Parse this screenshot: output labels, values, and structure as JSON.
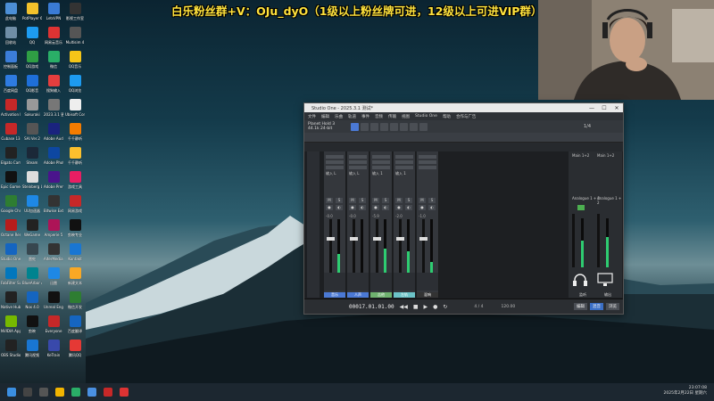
{
  "banner": {
    "text": "白乐粉丝群+V：OJu_dyO（1级以上粉丝牌可进，12级以上可进VIP群）"
  },
  "desktop": {
    "icons": [
      {
        "label": "此电脑",
        "color": "#4c8fd6"
      },
      {
        "label": "PotPlayer 64 bit",
        "color": "#f3c22b"
      },
      {
        "label": "LetsVPN",
        "color": "#3a7bd5"
      },
      {
        "label": "影视工作室",
        "color": "#333"
      },
      {
        "label": "回收站",
        "color": "#6f8ea6"
      },
      {
        "label": "QQ",
        "color": "#1d9bf0"
      },
      {
        "label": "网易云音乐",
        "color": "#d33"
      },
      {
        "label": "Multisim 4",
        "color": "#555"
      },
      {
        "label": "控制面板",
        "color": "#3b7dd8"
      },
      {
        "label": "QQ游戏",
        "color": "#2f9e44"
      },
      {
        "label": "微信",
        "color": "#2aae67"
      },
      {
        "label": "QQ音乐",
        "color": "#f5c518"
      },
      {
        "label": "百度网盘",
        "color": "#2e7be0"
      },
      {
        "label": "QQ影音",
        "color": "#1e6fd9"
      },
      {
        "label": "搜狗输入",
        "color": "#e53e3e"
      },
      {
        "label": "QQ浏览",
        "color": "#1d9bf0"
      },
      {
        "label": "Activation Manager",
        "color": "#c62828"
      },
      {
        "label": "Sakuraki",
        "color": "#999"
      },
      {
        "label": "2023.3.1 更新",
        "color": "#777"
      },
      {
        "label": "Ubisoft Connect",
        "color": "#eee"
      },
      {
        "label": "Cubase 13",
        "color": "#c62828"
      },
      {
        "label": "SAI Ver.2",
        "color": "#555"
      },
      {
        "label": "Adobe Audit",
        "color": "#1a237e"
      },
      {
        "label": "千千静听",
        "color": "#f57c00"
      },
      {
        "label": "Elgato Camera",
        "color": "#222"
      },
      {
        "label": "Steam",
        "color": "#1b2838"
      },
      {
        "label": "Adobe Photosh",
        "color": "#0d47a1"
      },
      {
        "label": "千千静听",
        "color": "#fbc02d"
      },
      {
        "label": "Epic Games Launcher",
        "color": "#111"
      },
      {
        "label": "Steinberg Library",
        "color": "#ddd"
      },
      {
        "label": "Adobe Premier",
        "color": "#4a148c"
      },
      {
        "label": "游戏工具",
        "color": "#e91e63"
      },
      {
        "label": "Google Chrome",
        "color": "#2e7d32"
      },
      {
        "label": "UU加速器",
        "color": "#1e88e5"
      },
      {
        "label": "Bitwise Extreme",
        "color": "#333"
      },
      {
        "label": "网易游戏",
        "color": "#c62828"
      },
      {
        "label": "Octane Render",
        "color": "#b71c1c"
      },
      {
        "label": "WeGame",
        "color": "#222"
      },
      {
        "label": "Amperie 5",
        "color": "#ad1457"
      },
      {
        "label": "剪映专业",
        "color": "#111"
      },
      {
        "label": "Studio One 6",
        "color": "#1565c0"
      },
      {
        "label": "雷蛇",
        "color": "#37474f"
      },
      {
        "label": "AlterMedia BKCentral",
        "color": "#333"
      },
      {
        "label": "Kontakt",
        "color": "#1976d2"
      },
      {
        "label": "FabFilter Suite",
        "color": "#0277bd"
      },
      {
        "label": "BlueArbor Architect",
        "color": "#00838f"
      },
      {
        "label": "迅雷",
        "color": "#1e88e5"
      },
      {
        "label": "新建文本",
        "color": "#f9a825"
      },
      {
        "label": "Native Hub",
        "color": "#222"
      },
      {
        "label": "Nox 4.0",
        "color": "#1565c0"
      },
      {
        "label": "Unreal Engine",
        "color": "#111"
      },
      {
        "label": "微信开发",
        "color": "#2e7d32"
      },
      {
        "label": "NVIDIA App",
        "color": "#76b900"
      },
      {
        "label": "剪映",
        "color": "#111"
      },
      {
        "label": "Everyone",
        "color": "#c62828"
      },
      {
        "label": "百度翻译",
        "color": "#1565c0"
      },
      {
        "label": "OBS Studio",
        "color": "#222"
      },
      {
        "label": "腾讯视频",
        "color": "#1976d2"
      },
      {
        "label": "KeTrain",
        "color": "#3949ab"
      },
      {
        "label": "腾讯QQ",
        "color": "#e53935"
      }
    ]
  },
  "studio_one": {
    "title": "Studio One - 2025.3.1 测试*",
    "window_buttons": [
      "—",
      "☐",
      "✕"
    ],
    "menu": [
      "文件",
      "编辑",
      "乐曲",
      "轨道",
      "事件",
      "音频",
      "传输",
      "视图",
      "Studio One",
      "帮助",
      "合作与广告"
    ],
    "song": {
      "name": "Planet Hold 3",
      "sub": "44.1k 24-bit"
    },
    "tools_label": "1/4",
    "strips": [
      {
        "name": "音乐",
        "input": "输入 L",
        "value": "-0.0",
        "color": "#4b79d4",
        "level": 0.35
      },
      {
        "name": "人声",
        "input": "输入 L",
        "value": "-0.0",
        "color": "#4b79d4",
        "level": 0.0
      },
      {
        "name": "吉他",
        "input": "输入 1",
        "value": "-5.9",
        "color": "#6fb26f",
        "level": 0.45
      },
      {
        "name": "左轨",
        "input": "输入 1",
        "value": "-2.0",
        "color": "#6cc3c7",
        "level": 0.4
      },
      {
        "name": "混响",
        "input": "",
        "value": "-1.0",
        "color": "#333",
        "level": 0.2
      }
    ],
    "right_strips": [
      {
        "name": "监听",
        "input": "Main 1+2",
        "value": "0.0"
      },
      {
        "name": "输出",
        "input": "Main 1+2",
        "value": "0.0"
      }
    ],
    "right_labels": [
      "Analogue 1 + 2",
      "Analogue 1 + 2"
    ],
    "transport": {
      "time": "00017.01.01.00",
      "signature": "4 / 4",
      "tempo": "120.00",
      "buttons": [
        "◀◀",
        "■",
        "▶",
        "●",
        "↻"
      ],
      "pills": [
        "编辑",
        "混音",
        "浏览"
      ]
    }
  },
  "taskbar": {
    "time": "23:07:08",
    "date": "2025年2月22日 星期六"
  }
}
